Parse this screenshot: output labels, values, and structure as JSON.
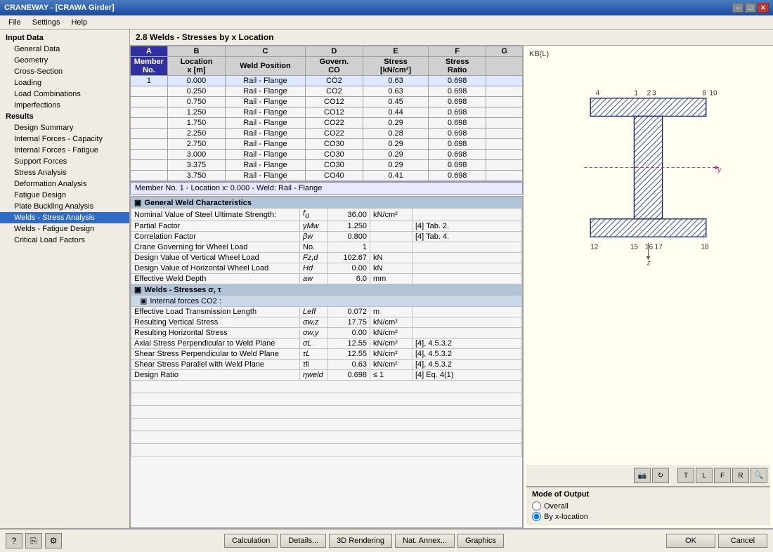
{
  "window": {
    "title": "CRANEWAY - [CRAWA Girder]",
    "close_label": "✕",
    "minimize_label": "─",
    "maximize_label": "□"
  },
  "menu": {
    "items": [
      "File",
      "Settings",
      "Help"
    ]
  },
  "sidebar": {
    "input_data_label": "Input Data",
    "items": [
      {
        "label": "General Data",
        "active": false
      },
      {
        "label": "Geometry",
        "active": false
      },
      {
        "label": "Cross-Section",
        "active": false
      },
      {
        "label": "Loading",
        "active": false
      },
      {
        "label": "Load Combinations",
        "active": false
      },
      {
        "label": "Imperfections",
        "active": false
      }
    ],
    "results_label": "Results",
    "result_items": [
      {
        "label": "Design Summary",
        "active": false
      },
      {
        "label": "Internal Forces - Capacity",
        "active": false
      },
      {
        "label": "Internal Forces - Fatigue",
        "active": false
      },
      {
        "label": "Support Forces",
        "active": false
      },
      {
        "label": "Stress Analysis",
        "active": false
      },
      {
        "label": "Deformation Analysis",
        "active": false
      },
      {
        "label": "Fatigue Design",
        "active": false
      },
      {
        "label": "Plate Buckling Analysis",
        "active": false
      },
      {
        "label": "Welds - Stress Analysis",
        "active": true
      },
      {
        "label": "Welds - Fatigue Design",
        "active": false
      },
      {
        "label": "Critical Load Factors",
        "active": false
      }
    ]
  },
  "content": {
    "title": "2.8 Welds - Stresses by x Location",
    "columns": [
      "A",
      "B",
      "C",
      "D",
      "E",
      "F",
      "G"
    ],
    "col_headers": [
      {
        "row1": "Member",
        "row2": "No."
      },
      {
        "row1": "Location",
        "row2": "x [m]"
      },
      {
        "row1": "",
        "row2": "Weld Position"
      },
      {
        "row1": "Govern.",
        "row2": "CO"
      },
      {
        "row1": "Stress",
        "row2": "[kN/cm²]"
      },
      {
        "row1": "Stress",
        "row2": "Ratio"
      },
      {
        "row1": "",
        "row2": ""
      }
    ],
    "rows": [
      {
        "member": "1",
        "location": "0.000",
        "weld_pos": "Rail - Flange",
        "co": "CO2",
        "stress": "0.63",
        "ratio": "0.698",
        "col_g": ""
      },
      {
        "member": "",
        "location": "0.250",
        "weld_pos": "Rail - Flange",
        "co": "CO2",
        "stress": "0.63",
        "ratio": "0.698",
        "col_g": ""
      },
      {
        "member": "",
        "location": "0.750",
        "weld_pos": "Rail - Flange",
        "co": "CO12",
        "stress": "0.45",
        "ratio": "0.698",
        "col_g": ""
      },
      {
        "member": "",
        "location": "1.250",
        "weld_pos": "Rail - Flange",
        "co": "CO12",
        "stress": "0.44",
        "ratio": "0.698",
        "col_g": ""
      },
      {
        "member": "",
        "location": "1.750",
        "weld_pos": "Rail - Flange",
        "co": "CO22",
        "stress": "0.29",
        "ratio": "0.698",
        "col_g": ""
      },
      {
        "member": "",
        "location": "2.250",
        "weld_pos": "Rail - Flange",
        "co": "CO22",
        "stress": "0.28",
        "ratio": "0.698",
        "col_g": ""
      },
      {
        "member": "",
        "location": "2.750",
        "weld_pos": "Rail - Flange",
        "co": "CO30",
        "stress": "0.29",
        "ratio": "0.698",
        "col_g": ""
      },
      {
        "member": "",
        "location": "3.000",
        "weld_pos": "Rail - Flange",
        "co": "CO30",
        "stress": "0.29",
        "ratio": "0.698",
        "col_g": ""
      },
      {
        "member": "",
        "location": "3.375",
        "weld_pos": "Rail - Flange",
        "co": "CO30",
        "stress": "0.29",
        "ratio": "0.698",
        "col_g": ""
      },
      {
        "member": "",
        "location": "3.750",
        "weld_pos": "Rail - Flange",
        "co": "CO40",
        "stress": "0.41",
        "ratio": "0.698",
        "col_g": ""
      }
    ],
    "selected_info": "Member No. 1  -  Location x: 0.000  -  Weld: Rail - Flange",
    "detail_sections": [
      {
        "title": "General Weld Characteristics",
        "rows": [
          {
            "label": "Nominal Value of Steel Ultimate Strength:",
            "symbol": "fu",
            "value": "36.00",
            "unit": "kN/cm²",
            "ref": ""
          },
          {
            "label": "Partial Factor",
            "symbol": "γMw",
            "value": "1.250",
            "unit": "",
            "ref": "[4] Tab. 2."
          },
          {
            "label": "Correlation Factor",
            "symbol": "βw",
            "value": "0.800",
            "unit": "",
            "ref": "[4] Tab. 4."
          },
          {
            "label": "Crane Governing for Wheel Load",
            "symbol": "No.",
            "value": "1",
            "unit": "",
            "ref": ""
          },
          {
            "label": "Design Value of Vertical Wheel Load",
            "symbol": "Fz,d",
            "value": "102.67",
            "unit": "kN",
            "ref": ""
          },
          {
            "label": "Design Value of Horizontal Wheel Load",
            "symbol": "Hd",
            "value": "0.00",
            "unit": "kN",
            "ref": ""
          },
          {
            "label": "Effective Weld Depth",
            "symbol": "aw",
            "value": "6.0",
            "unit": "mm",
            "ref": ""
          }
        ]
      },
      {
        "title": "Welds - Stresses σ, τ",
        "subsections": [
          {
            "title": "Internal forces CO2 :",
            "rows": [
              {
                "label": "Effective Load Transmission Length",
                "symbol": "Leff",
                "value": "0.072",
                "unit": "m",
                "ref": ""
              },
              {
                "label": "Resulting Vertical Stress",
                "symbol": "σw,z",
                "value": "17.75",
                "unit": "kN/cm²",
                "ref": ""
              },
              {
                "label": "Resulting Horizontal Stress",
                "symbol": "σw,y",
                "value": "0.00",
                "unit": "kN/cm²",
                "ref": ""
              },
              {
                "label": "Axial Stress Perpendicular to Weld Plane",
                "symbol": "σL",
                "value": "12.55",
                "unit": "kN/cm²",
                "ref": "[4], 4.5.3.2"
              },
              {
                "label": "Shear Stress Perpendicular to Weld Plane",
                "symbol": "τL",
                "value": "12.55",
                "unit": "kN/cm²",
                "ref": "[4], 4.5.3.2"
              },
              {
                "label": "Shear Stress Parallel with Weld Plane",
                "symbol": "τ‖",
                "value": "0.63",
                "unit": "kN/cm²",
                "ref": "[4], 4.5.3.2"
              },
              {
                "label": "Design Ratio",
                "symbol": "ηweld",
                "value": "0.698",
                "unit": "≤ 1",
                "ref": "[4] Eq. 4(1)"
              }
            ]
          }
        ]
      }
    ]
  },
  "right_panel": {
    "kb_label": "KB(L)",
    "toolbar_buttons": [
      "camera",
      "rotate",
      "select-top",
      "select-left",
      "select-front",
      "select-right",
      "zoom-fit"
    ]
  },
  "mode_output": {
    "title": "Mode of Output",
    "options": [
      {
        "label": "Overall",
        "selected": false
      },
      {
        "label": "By x-location",
        "selected": true
      }
    ]
  },
  "bottom_bar": {
    "icon_buttons": [
      "help",
      "copy",
      "settings"
    ],
    "action_buttons": [
      "Calculation",
      "Details...",
      "3D Rendering",
      "Nat. Annex...",
      "Graphics"
    ],
    "ok_label": "OK",
    "cancel_label": "Cancel"
  }
}
